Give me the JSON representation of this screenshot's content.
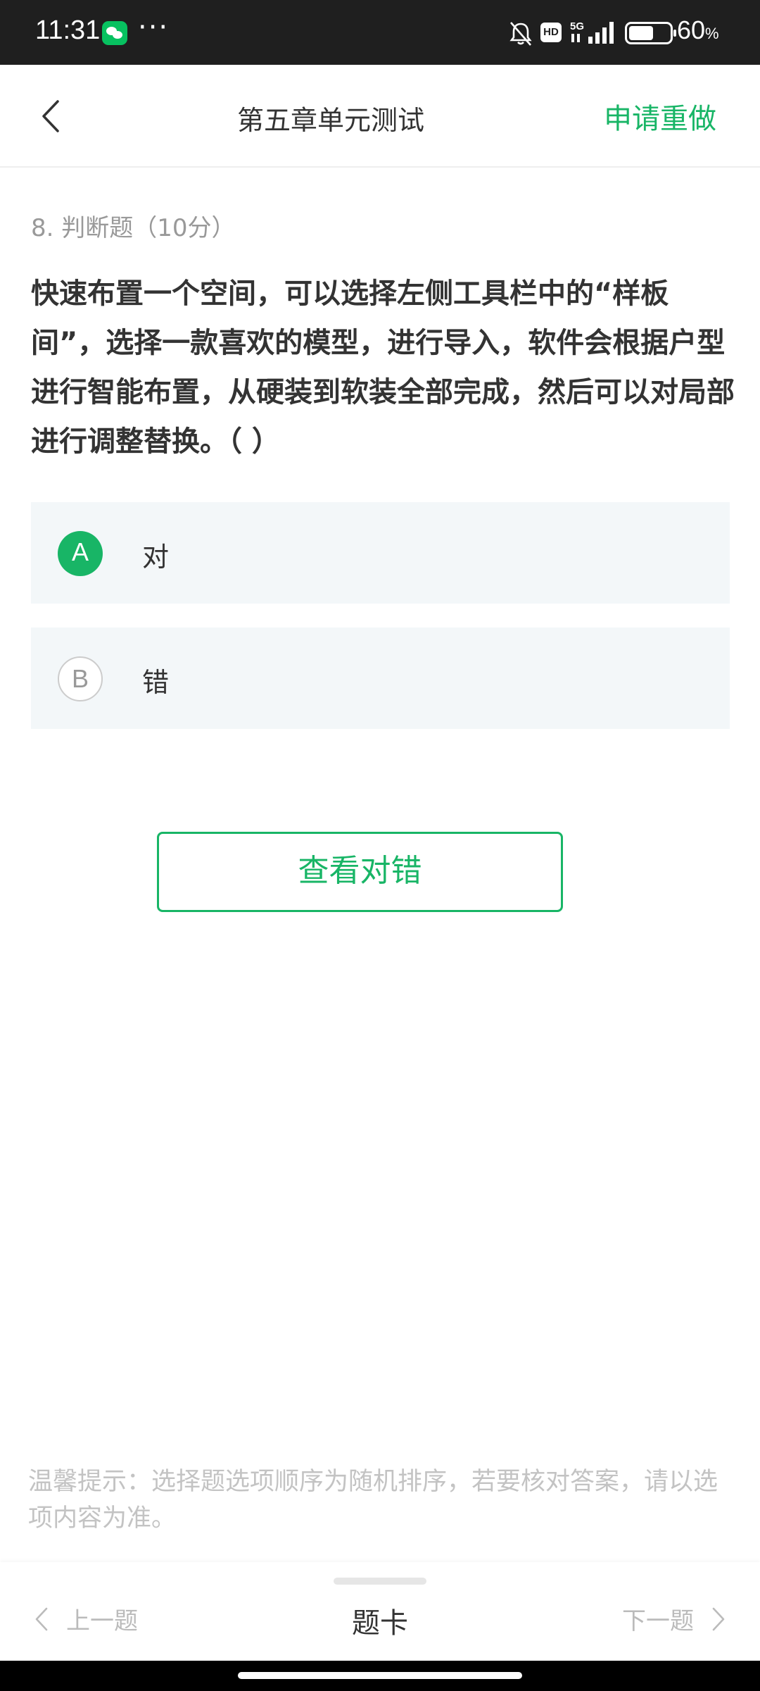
{
  "status_bar": {
    "time": "11:31",
    "more": "···",
    "network": "5G",
    "hd_badge": "HD",
    "battery_level": "60",
    "battery_unit": "%"
  },
  "header": {
    "title": "第五章单元测试",
    "redo_label": "申请重做"
  },
  "question": {
    "meta": "8. 判断题（10分）",
    "text": "快速布置一个空间，可以选择左侧工具栏中的“样板间”，选择一款喜欢的模型，进行导入，软件会根据户型进行智能布置，从硬装到软装全部完成，然后可以对局部进行调整替换。（ ）"
  },
  "options": [
    {
      "letter": "A",
      "label": "对",
      "selected": true
    },
    {
      "letter": "B",
      "label": "错",
      "selected": false
    }
  ],
  "check_button_label": "查看对错",
  "tip": "温馨提示：选择题选项顺序为随机排序，若要核对答案，请以选项内容为准。",
  "bottom_nav": {
    "prev_label": "上一题",
    "card_label": "题卡",
    "next_label": "下一题"
  },
  "colors": {
    "accent": "#18b566",
    "option_bg": "#f3f7f9",
    "muted_text": "#999999",
    "tip_text": "#c3c3c3"
  }
}
